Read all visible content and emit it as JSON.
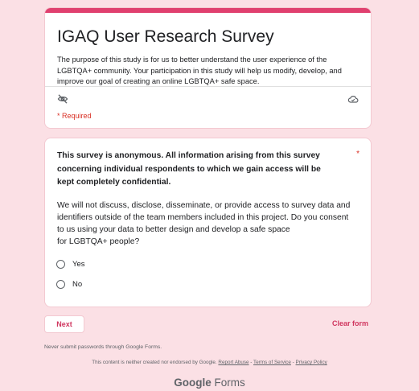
{
  "header": {
    "title": "IGAQ User Research Survey",
    "description": "The purpose of this study is for us to better understand the user experience of the LGBTQA+ community. Your participation in this study will help us modify, develop, and improve our goal of creating an online LGBTQA+ safe space.",
    "required_note": "* Required"
  },
  "question": {
    "title": "This survey is anonymous. All information arising from this survey concerning individual respondents to which we gain access will be kept completely confidential.",
    "required_star": "*",
    "body_lines": [
      "We will not discuss, disclose, disseminate, or provide access to survey data and",
      "identifiers outside of the team members included in this project. Do you consent",
      "to us using your data to better design and develop a safe space",
      "for LGBTQA+ people?"
    ],
    "options": [
      "Yes",
      "No"
    ]
  },
  "actions": {
    "next_label": "Next",
    "clear_label": "Clear form"
  },
  "footer": {
    "password_note": "Never submit passwords through Google Forms.",
    "legal_prefix": "This content is neither created nor endorsed by Google.",
    "report_abuse": "Report Abuse",
    "sep1": " - ",
    "terms": "Terms of Service",
    "sep2": " - ",
    "privacy": "Privacy Policy",
    "brand_google": "Google",
    "brand_forms": " Forms"
  },
  "colors": {
    "accent": "#e0406f",
    "page_bg": "#fbe0e5",
    "required": "#d93025"
  }
}
